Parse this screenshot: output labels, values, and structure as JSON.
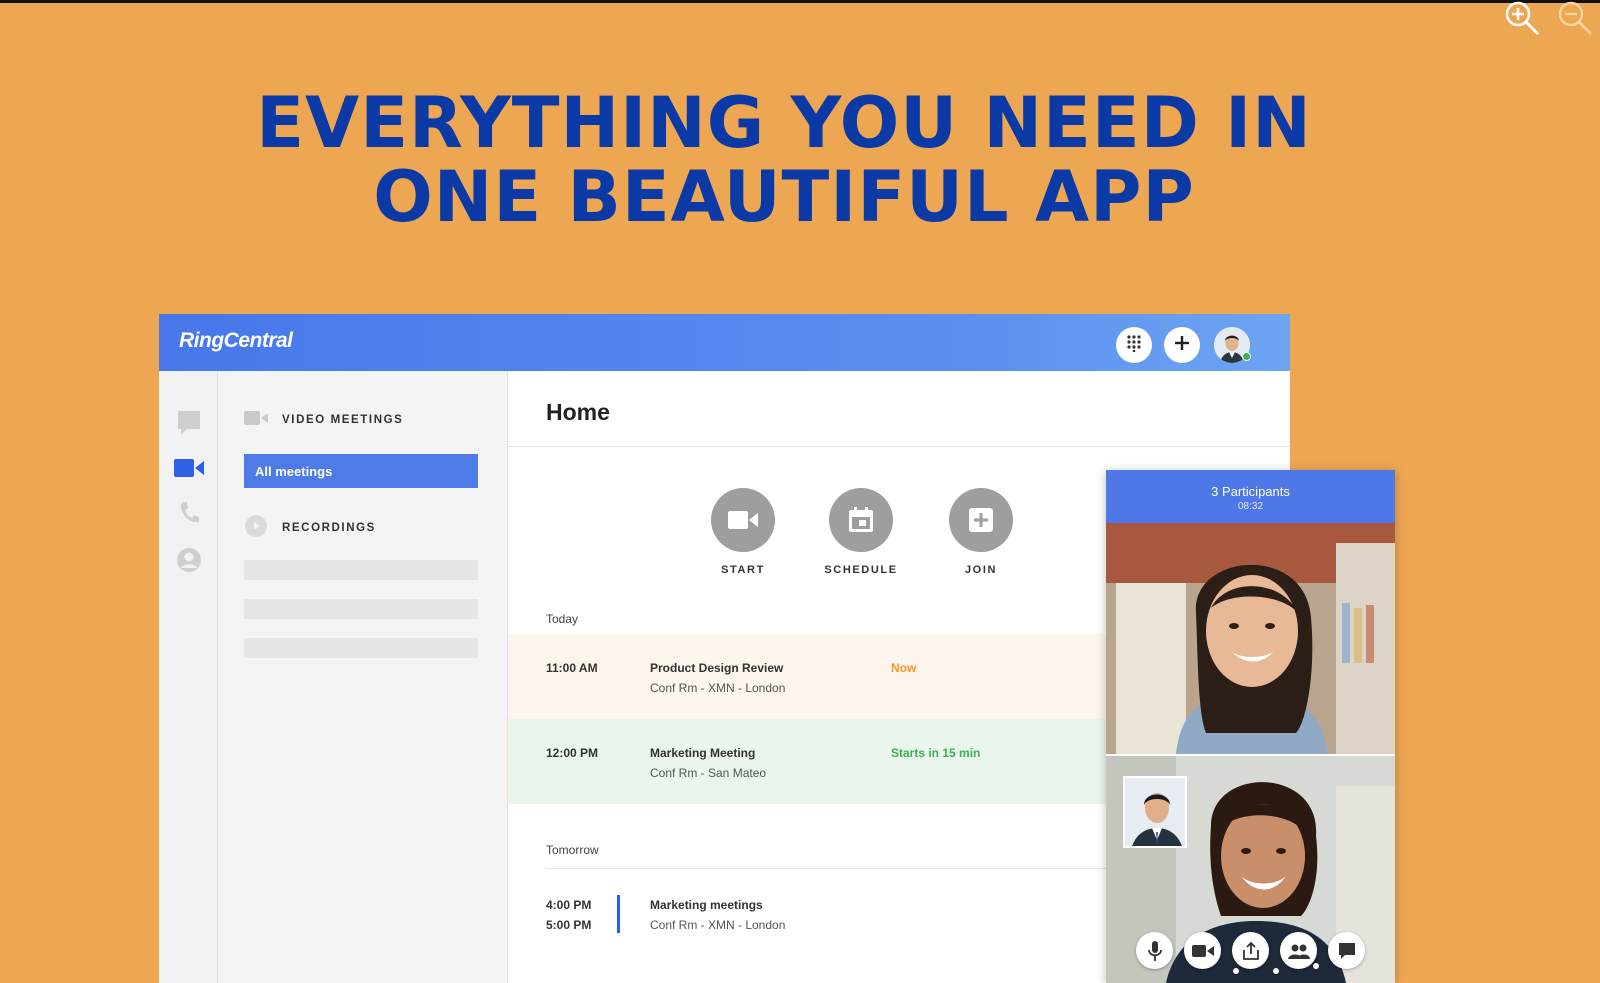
{
  "page": {
    "headline_line1": "EVERYTHING YOU NEED IN",
    "headline_line2": "ONE BEAUTIFUL APP",
    "background_color": "#EDA652",
    "headline_color": "#0B3AA6",
    "zoom_controls": [
      "zoom-in-icon",
      "zoom-out-icon"
    ]
  },
  "app": {
    "logo": "RingCentral",
    "header_icons": [
      "dialpad-icon",
      "plus-icon",
      "avatar"
    ],
    "rail_icons": [
      "message-icon",
      "video-icon",
      "phone-icon",
      "contacts-icon"
    ],
    "nav": {
      "video_meetings_label": "VIDEO MEETINGS",
      "active_item": "All meetings",
      "recordings_label": "RECORDINGS"
    },
    "main": {
      "title": "Home",
      "actions": [
        {
          "label": "START",
          "icon": "video-camera-icon"
        },
        {
          "label": "SCHEDULE",
          "icon": "calendar-icon"
        },
        {
          "label": "JOIN",
          "icon": "plus-square-icon"
        }
      ],
      "today_label": "Today",
      "tomorrow_label": "Tomorrow",
      "meetings_today": [
        {
          "time": "11:00 AM",
          "title": "Product Design Review",
          "room": "Conf Rm - XMN - London",
          "status": "Now",
          "status_color": "#F0962A"
        },
        {
          "time": "12:00 PM",
          "title": "Marketing Meeting",
          "room": "Conf Rm - San Mateo",
          "status": "Starts in 15 min",
          "status_color": "#3DB14E"
        }
      ],
      "meetings_tomorrow": [
        {
          "time_start": "4:00 PM",
          "time_end": "5:00 PM",
          "title": "Marketing meetings",
          "room": "Conf Rm - XMN - London"
        }
      ]
    }
  },
  "call": {
    "participants": "3 Participants",
    "timer": "08:32",
    "controls": [
      "microphone-icon",
      "camera-icon",
      "share-icon",
      "participants-icon",
      "chat-icon"
    ]
  }
}
